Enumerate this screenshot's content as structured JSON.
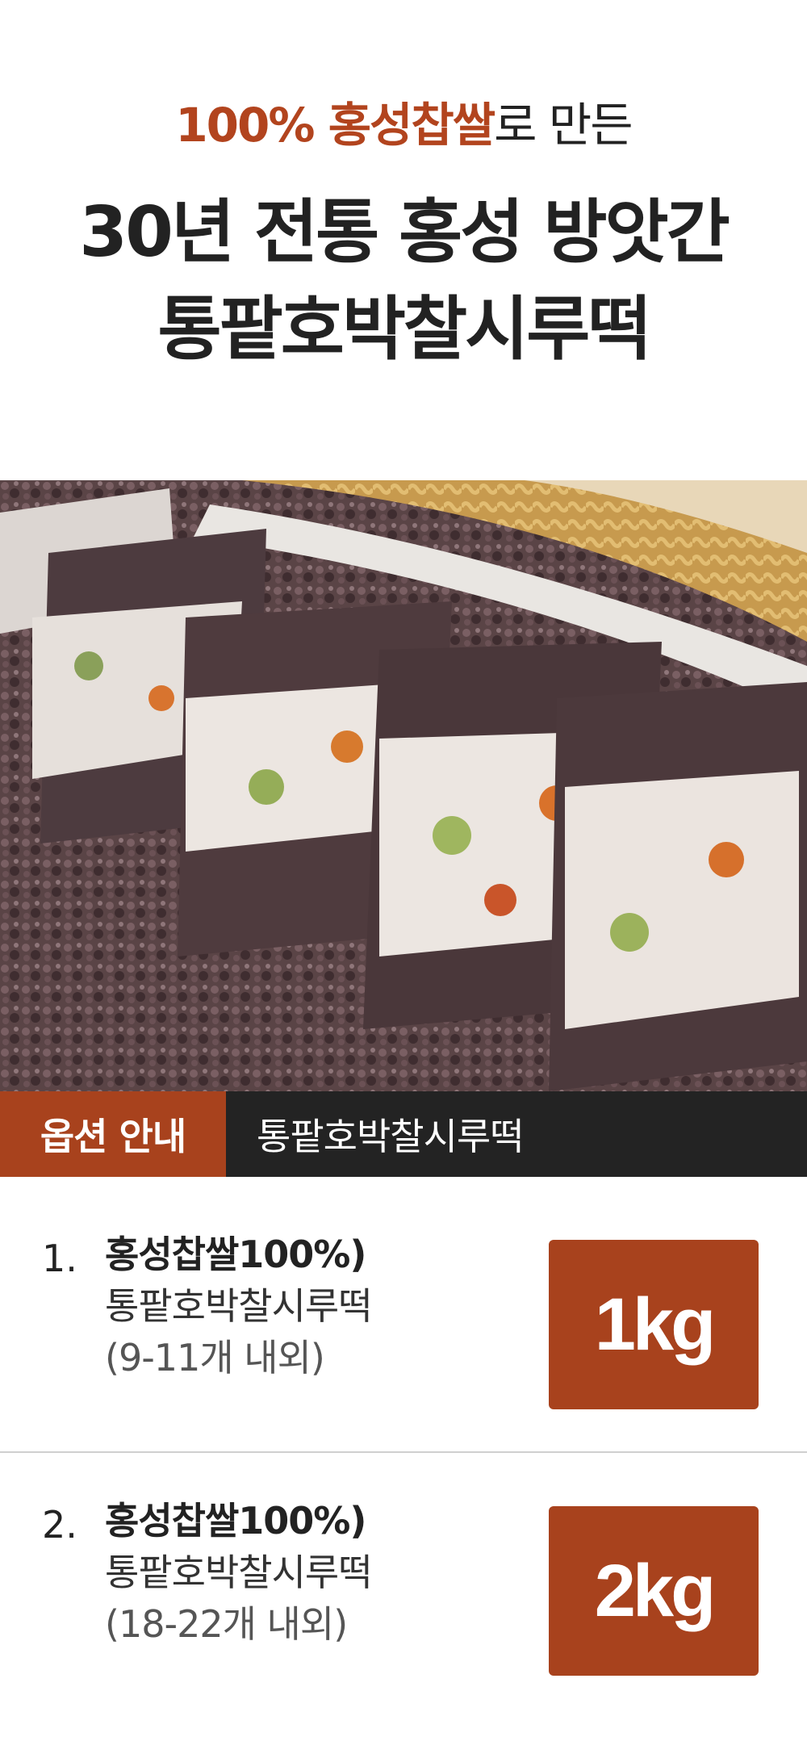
{
  "header": {
    "subtitle_accent": "100% 홍성찹쌀",
    "subtitle_rest": "로 만든",
    "title_line1": "30년 전통 홍성 방앗간",
    "title_line2": "통팥호박찰시루떡"
  },
  "option_bar": {
    "tag": "옵션 안내",
    "name": "통팥호박찰시루떡"
  },
  "options": [
    {
      "number": "1.",
      "line1": "홍성찹쌀100%)",
      "line2": "통팥호박찰시루떡",
      "line3": "(9-11개 내외)",
      "weight": "1kg"
    },
    {
      "number": "2.",
      "line1": "홍성찹쌀100%)",
      "line2": "통팥호박찰시루떡",
      "line3": "(18-22개 내외)",
      "weight": "2kg"
    }
  ],
  "colors": {
    "accent": "#a8421d",
    "bar_dark": "#232323"
  }
}
